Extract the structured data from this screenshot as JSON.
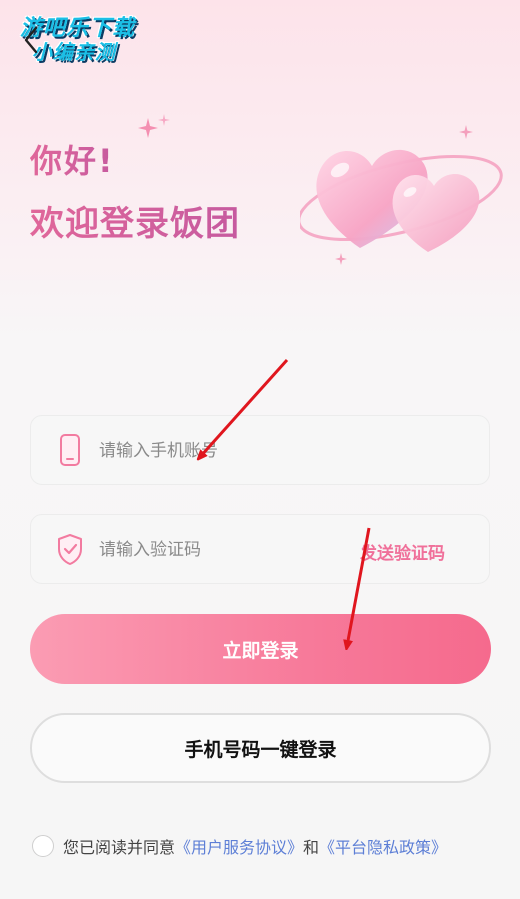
{
  "watermark": {
    "line1": "游吧乐下载",
    "line2": "小编亲测"
  },
  "greeting": {
    "line1": "你好!",
    "line2": "欢迎登录饭团"
  },
  "phone_field": {
    "placeholder": "请输入手机账号",
    "icon": "phone-icon"
  },
  "code_field": {
    "placeholder": "请输入验证码",
    "icon": "shield-check-icon",
    "send_code_label": "发送验证码"
  },
  "login_button": {
    "label": "立即登录"
  },
  "quick_login_button": {
    "label": "手机号码一键登录"
  },
  "agreement": {
    "prefix": "您已阅读并同意",
    "user_agreement": "《用户服务协议》",
    "conjunction": "和",
    "privacy_policy": "《平台隐私政策》"
  },
  "colors": {
    "accent": "#f77a9a",
    "link": "#5d7fd6",
    "annotation_arrow": "#e0161e"
  }
}
